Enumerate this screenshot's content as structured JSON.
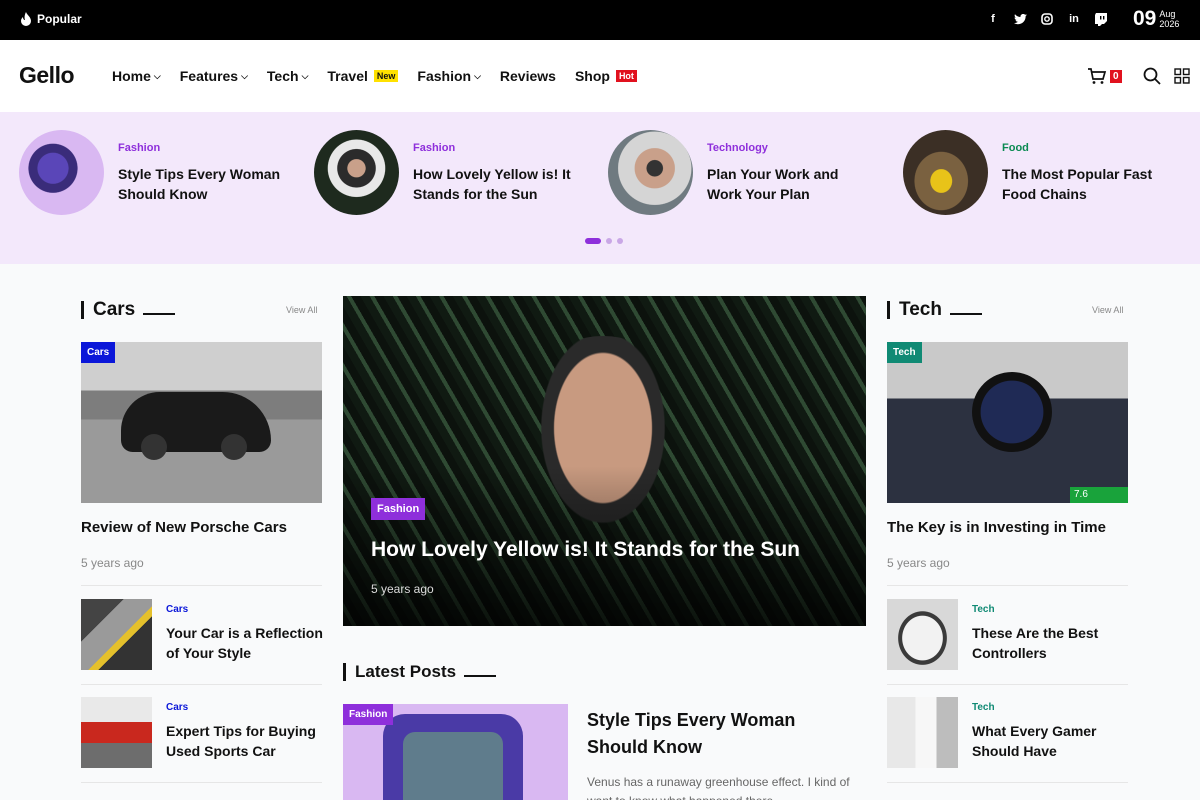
{
  "topbar": {
    "popular_label": "Popular",
    "date_day": "09",
    "date_month": "Aug",
    "date_year": "2026",
    "socials": [
      "facebook-icon",
      "twitter-icon",
      "instagram-icon",
      "linkedin-icon",
      "twitch-icon"
    ]
  },
  "header": {
    "logo": "Gello",
    "nav": [
      {
        "label": "Home",
        "dropdown": true
      },
      {
        "label": "Features",
        "dropdown": true
      },
      {
        "label": "Tech",
        "dropdown": true
      },
      {
        "label": "Travel",
        "badge": "New"
      },
      {
        "label": "Fashion",
        "dropdown": true
      },
      {
        "label": "Reviews"
      },
      {
        "label": "Shop",
        "badge": "Hot"
      }
    ],
    "cart_count": "0"
  },
  "carousel": [
    {
      "category": "Fashion",
      "title": "Style Tips Every Woman Should Know",
      "cat_color": "#8e2fdb"
    },
    {
      "category": "Fashion",
      "title": "How Lovely Yellow is! It Stands for the Sun",
      "cat_color": "#8e2fdb"
    },
    {
      "category": "Technology",
      "title": "Plan Your Work and Work Your Plan",
      "cat_color": "#8e2fdb"
    },
    {
      "category": "Food",
      "title": "The Most Popular Fast Food Chains",
      "cat_color": "#0a8a52"
    }
  ],
  "cars": {
    "heading": "Cars",
    "view_all": "View All",
    "featured": {
      "tag": "Cars",
      "title": "Review of New Porsche Cars",
      "meta": "5 years ago"
    },
    "items": [
      {
        "category": "Cars",
        "title": "Your Car is a Reflection of Your Style"
      },
      {
        "category": "Cars",
        "title": "Expert Tips for Buying Used Sports Car"
      }
    ]
  },
  "hero": {
    "tag": "Fashion",
    "title": "How Lovely Yellow is! It Stands for the Sun",
    "meta": "5 years ago"
  },
  "latest": {
    "heading": "Latest Posts",
    "post": {
      "tag": "Fashion",
      "title": "Style Tips Every Woman Should Know",
      "excerpt": "Venus has a runaway greenhouse effect. I kind of want to know what happened there"
    }
  },
  "tech": {
    "heading": "Tech",
    "view_all": "View All",
    "featured": {
      "tag": "Tech",
      "score": "7.6",
      "score_fraction": 0.76,
      "title": "The Key is in Investing in Time",
      "meta": "5 years ago"
    },
    "items": [
      {
        "category": "Tech",
        "title": "These Are the Best Controllers"
      },
      {
        "category": "Tech",
        "title": "What Every Gamer Should Have"
      }
    ]
  },
  "colors": {
    "accent": "#8e2fdb",
    "cars_tag": "#0b17d9",
    "tech_tag": "#108a74",
    "hot": "#e1111e",
    "new": "#ffe100"
  }
}
